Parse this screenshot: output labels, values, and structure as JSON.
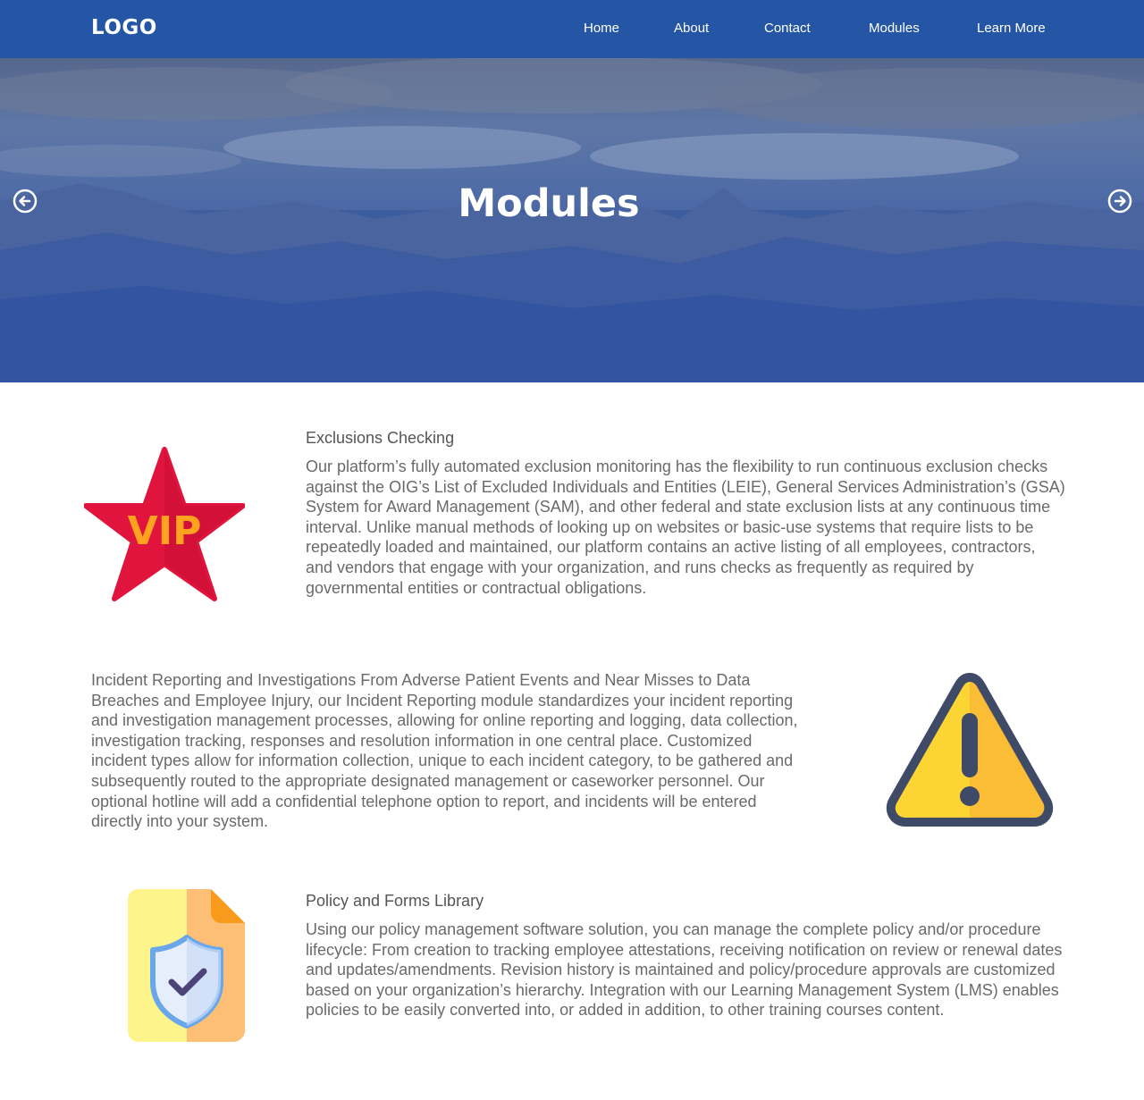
{
  "nav": {
    "logo": "LOGO",
    "links": [
      "Home",
      "About",
      "Contact",
      "Modules",
      "Learn More"
    ]
  },
  "hero": {
    "title": "Modules",
    "prev_icon": "arrow-left-circle-icon",
    "next_icon": "arrow-right-circle-icon"
  },
  "sections": [
    {
      "title": "Exclusions Checking",
      "icon": "vip-star-icon",
      "body": "Our platform’s fully automated exclusion monitoring has the flexibility to run continuous exclusion checks against the OIG’s List of Excluded Individuals and Entities (LEIE), General Services Administration’s (GSA) System for Award Management (SAM), and other federal and state exclusion lists at any continuous time interval. Unlike manual methods of looking up on websites or basic-use systems that require lists to be repeatedly loaded and maintained, our platform contains an active listing of all employees, contractors, and vendors that engage with your organization, and runs checks as frequently as required by governmental entities or contractual obligations."
    },
    {
      "icon": "warning-icon",
      "body": "Incident Reporting and Investigations From Adverse Patient Events and Near Misses to Data Breaches and Employee Injury, our Incident Reporting module standardizes your incident reporting and investigation management processes, allowing for online reporting and logging, data collection, investigation tracking, responses and resolution information in one central place. Customized incident types allow for information collection, unique to each incident category, to be gathered and subsequently routed to the appropriate designated management or caseworker personnel. Our optional hotline will add a confidential telephone option to report, and incidents will be entered directly into your system."
    },
    {
      "title": "Policy and Forms Library",
      "icon": "policy-document-shield-icon",
      "body": "Using our policy management software solution, you can manage the complete policy and/or procedure lifecycle: From creation to tracking employee attestations, receiving notification on review or renewal dates and updates/amendments. Revision history is maintained and policy/procedure approvals are customized based on your organization’s hierarchy. Integration with our Learning Management System (LMS) enables policies to be easily converted into, or added in addition, to other training courses content."
    }
  ],
  "vip_text": "VIP",
  "colors": {
    "nav_bg": "#2556a6",
    "vip_red": "#e0143c",
    "vip_text": "#ffa21f",
    "warning_yellow": "#fcd535",
    "warning_outline": "#3f4a66"
  }
}
